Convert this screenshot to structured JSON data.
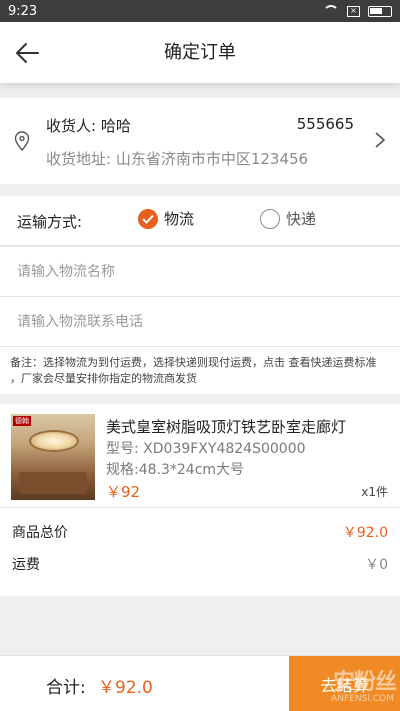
{
  "status_bar": {
    "time": "9:23"
  },
  "header": {
    "title": "确定订单"
  },
  "address": {
    "receiver": "收货人: 哈哈",
    "phone": "555665",
    "address_line": "收货地址: 山东省济南市市中区123456"
  },
  "shipping": {
    "label": "运输方式:",
    "options": [
      {
        "label": "物流",
        "checked": true
      },
      {
        "label": "快递",
        "checked": false
      }
    ],
    "logistics_name_placeholder": "请输入物流名称",
    "logistics_phone_placeholder": "请输入物流联系电话",
    "note": "备注：选择物流为到付运费，选择快递则现付运费，点击 查看快递运费标准 ，厂家会尽量安排你指定的物流商发货"
  },
  "product": {
    "name": "美式皇室树脂吸顶灯铁艺卧室走廊灯",
    "model": "型号: XD039FXY4824S00000",
    "spec": "规格:48.3*24cm大号",
    "price": "￥92",
    "quantity": "x1件",
    "brand_badge": "德翰"
  },
  "summary": {
    "goods_total_label": "商品总价",
    "goods_total_value": "￥92.0",
    "freight_label": "运费",
    "freight_value": "￥0"
  },
  "footer": {
    "total_label": "合计:",
    "total_value": "￥92.0",
    "checkout_label": "去结算",
    "watermark": "安粉丝",
    "watermark_sub": "ANFENSI.COM"
  },
  "colors": {
    "accent": "#e8601d",
    "checkout": "#f08a24"
  }
}
